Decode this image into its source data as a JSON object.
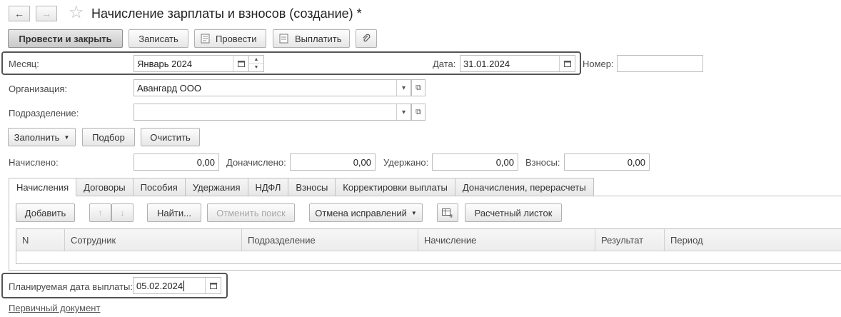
{
  "window": {
    "title": "Начисление зарплаты и взносов (создание) *"
  },
  "toolbar": {
    "post_close": "Провести и закрыть",
    "save": "Записать",
    "post": "Провести",
    "pay": "Выплатить"
  },
  "header": {
    "month_label": "Месяц:",
    "month_value": "Январь 2024",
    "date_label": "Дата:",
    "date_value": "31.01.2024",
    "number_label": "Номер:",
    "number_value": "",
    "org_label": "Организация:",
    "org_value": "Авангард ООО",
    "dept_label": "Подразделение:",
    "dept_value": ""
  },
  "actions": {
    "fill": "Заполнить",
    "pick": "Подбор",
    "clear": "Очистить"
  },
  "totals": {
    "accrued_label": "Начислено:",
    "accrued_value": "0,00",
    "extra_label": "Доначислено:",
    "extra_value": "0,00",
    "withheld_label": "Удержано:",
    "withheld_value": "0,00",
    "contrib_label": "Взносы:",
    "contrib_value": "0,00"
  },
  "tabs": [
    {
      "label": "Начисления",
      "active": true
    },
    {
      "label": "Договоры"
    },
    {
      "label": "Пособия"
    },
    {
      "label": "Удержания"
    },
    {
      "label": "НДФЛ"
    },
    {
      "label": "Взносы"
    },
    {
      "label": "Корректировки выплаты"
    },
    {
      "label": "Доначисления, перерасчеты"
    }
  ],
  "table_toolbar": {
    "add": "Добавить",
    "find": "Найти...",
    "cancel_search": "Отменить поиск",
    "cancel_fix": "Отмена исправлений",
    "payslip": "Расчетный листок"
  },
  "table": {
    "columns": [
      "N",
      "Сотрудник",
      "Подразделение",
      "Начисление",
      "Результат",
      "Период"
    ]
  },
  "footer": {
    "planned_date_label": "Планируемая дата выплаты:",
    "planned_date_value": "05.02.2024",
    "primary_doc_link": "Первичный документ"
  }
}
